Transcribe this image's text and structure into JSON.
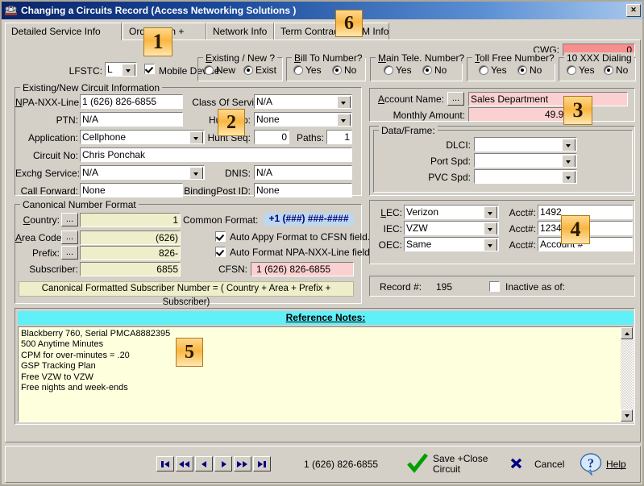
{
  "window": {
    "title": "Changing a Circuits Record  (Access Networking Solutions                             )",
    "icon": "telephone-icon",
    "close_label": "✕"
  },
  "tabs": [
    {
      "label": "Detailed Service Info",
      "selected": true
    },
    {
      "label": "Order Plan +",
      "selected": false
    },
    {
      "label": "Network Info",
      "selected": false
    },
    {
      "label": "Term Contract +TEM Info",
      "selected": false
    }
  ],
  "cwg": {
    "label": "CWG:",
    "value": "0"
  },
  "top_row": {
    "lfstc_label": "LFSTC:",
    "lfstc_value": "L",
    "mobile_device_label": "Mobile Device",
    "mobile_device_checked": true,
    "groups": [
      {
        "title": "Existing / New ?",
        "options": [
          "New",
          "Exist"
        ],
        "selected": "Exist"
      },
      {
        "title": "Bill To Number?",
        "options": [
          "Yes",
          "No"
        ],
        "selected": "No"
      },
      {
        "title": "Main Tele. Number?",
        "options": [
          "Yes",
          "No"
        ],
        "selected": "No"
      },
      {
        "title": "Toll Free Number?",
        "options": [
          "Yes",
          "No"
        ],
        "selected": "No"
      },
      {
        "title": "10 XXX Dialing",
        "options": [
          "Yes",
          "No"
        ],
        "selected": "No"
      }
    ]
  },
  "circuit": {
    "title": "Existing/New Circuit Information",
    "npa_label": "NPA-NXX-Line:",
    "npa_value": "1 (626)  826-6855",
    "ptn_label": "PTN:",
    "ptn_value": "N/A",
    "application_label": "Application:",
    "application_value": "Cellphone",
    "circuit_no_label": "Circuit No:",
    "circuit_no_value": "Chris Ponchak",
    "exchg_label": "Exchg Service:",
    "exchg_value": "N/A",
    "call_forward_label": "Call Forward:",
    "call_forward_value": "None",
    "class_label": "Class Of Service:",
    "class_value": "N/A",
    "hunt_grp_label": "Hunt Grp:",
    "hunt_grp_value": "None",
    "hunt_seq_label": "Hunt Seq:",
    "hunt_seq_value": "0",
    "paths_label": "Paths:",
    "paths_value": "1",
    "dnis_label": "DNIS:",
    "dnis_value": "N/A",
    "binding_label": "BindingPost ID:",
    "binding_value": "None"
  },
  "account": {
    "name_label": "Account Name:",
    "browse_label": "...",
    "name_value": "Sales Department",
    "amount_label": "Monthly Amount:",
    "amount_value": "49.95"
  },
  "dataframe": {
    "title": "Data/Frame:",
    "dlci_label": "DLCI:",
    "dlci_value": "",
    "port_label": "Port Spd:",
    "port_value": "",
    "pvc_label": "PVC Spd:",
    "pvc_value": ""
  },
  "canonical": {
    "title": "Canonical Number Format",
    "country_label": "Country:",
    "country_btn": "...",
    "country_value": "1",
    "area_label": "Area Code:",
    "area_btn": "...",
    "area_value": "(626)",
    "prefix_label": "Prefix:",
    "prefix_btn": "...",
    "prefix_value": "826-",
    "subscriber_label": "Subscriber:",
    "subscriber_value": "6855",
    "common_format_label": "Common Format:",
    "common_format_value": "+1 (###) ###-####",
    "auto_apply_label": "Auto Appy Format to CFSN field.",
    "auto_apply_checked": true,
    "auto_format_label": "Auto Format NPA-NXX-Line field",
    "auto_format_checked": true,
    "cfsn_label": "CFSN:",
    "cfsn_value": "1 (626)  826-6855",
    "footnote": "Canonical Formatted Subscriber Number =  ( Country + Area + Prefix + Subscriber)"
  },
  "carriers": {
    "rows": [
      {
        "label": "LEC:",
        "value": "Verizon",
        "acct_label": "Acct#:",
        "acct_value": "1492"
      },
      {
        "label": "IEC:",
        "value": "VZW",
        "acct_label": "Acct#:",
        "acct_value": "12345"
      },
      {
        "label": "OEC:",
        "value": "Same",
        "acct_label": "Acct#:",
        "acct_value": "Account #"
      }
    ]
  },
  "record": {
    "record_label": "Record #:",
    "record_value": "195",
    "inactive_label": "Inactive as of:",
    "inactive_checked": false
  },
  "notes": {
    "header": "Reference Notes:",
    "lines": [
      "Blackberry 760, Serial PMCA8882395",
      "500 Anytime Minutes",
      "CPM for over-minutes = .20",
      "GSP Tracking Plan",
      "Free VZW to VZW",
      "Free nights and week-ends"
    ]
  },
  "footer": {
    "nav": [
      "first-record",
      "previous-page",
      "previous-record",
      "next-record",
      "next-page",
      "last-record"
    ],
    "status_number": "1 (626)  826-6855",
    "save_label_line1": "Save +Close",
    "save_label_line2": "Circuit",
    "cancel_label": "Cancel",
    "help_label": "Help"
  },
  "callouts": [
    {
      "n": "1"
    },
    {
      "n": "2"
    },
    {
      "n": "3"
    },
    {
      "n": "4"
    },
    {
      "n": "5"
    },
    {
      "n": "6"
    }
  ],
  "colors": {
    "window_face": "#d4d0c8",
    "title_start": "#0a246a",
    "pink_field": "#fad0d0",
    "red_field": "#f98e8e",
    "yellow_field": "#eeeeca",
    "notes_header": "#5ff0f8",
    "notes_body": "#feffdd",
    "badge": "#f9b642"
  }
}
